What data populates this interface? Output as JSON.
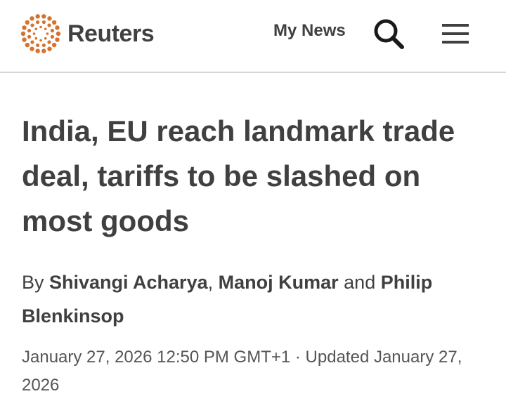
{
  "header": {
    "logo_text": "Reuters",
    "logo_icon": "reuters-dot-ring-icon",
    "my_news_label": "My News",
    "search_icon": "search-icon",
    "menu_icon": "hamburger-menu-icon",
    "brand_color": "#d6722e"
  },
  "article": {
    "headline": "India, EU reach landmark trade deal, tariffs to be slashed on most goods",
    "byline": {
      "prefix": "By ",
      "authors": [
        "Shivangi Acharya",
        "Manoj Kumar",
        "Philip Blenkinsop"
      ],
      "sep1": ", ",
      "sep2": " and "
    },
    "published": "January 27, 2026 12:50 PM GMT+1",
    "separator": " · ",
    "updated": "Updated January 27, 2026"
  }
}
